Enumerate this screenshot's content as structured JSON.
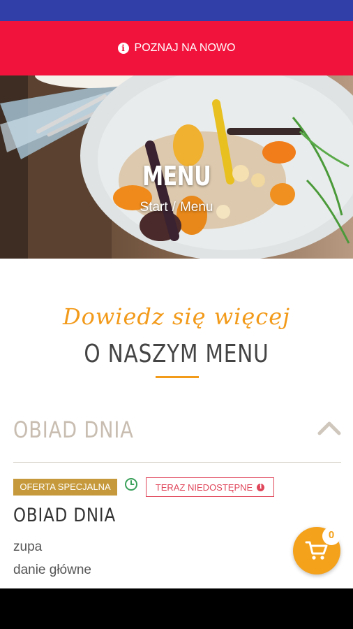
{
  "promo": {
    "text": "POZNAJ NA NOWO",
    "icon": "info-icon"
  },
  "hero": {
    "title": "MENU",
    "breadcrumb": {
      "home": "Start",
      "separator": "/",
      "current": "Menu"
    }
  },
  "about": {
    "script_heading": "Dowiedz się więcej",
    "heading": "O NASZYM MENU"
  },
  "section": {
    "title": "OBIAD DNIA",
    "toggle_icon": "chevron-up-icon"
  },
  "item": {
    "badge_special": "OFERTA SPECJALNA",
    "badge_unavailable": "TERAZ NIEDOSTĘPNE",
    "clock_icon": "clock-icon",
    "title": "OBIAD DNIA",
    "lines": [
      "zupa",
      "danie główne"
    ]
  },
  "cart": {
    "count": "0",
    "icon": "cart-icon"
  },
  "colors": {
    "status_bar": "#3140a8",
    "promo_bar": "#f2133c",
    "accent": "#f29a1a",
    "special_badge": "#c69a3c",
    "unavailable": "#e0465a",
    "cart": "#f4a11b"
  }
}
